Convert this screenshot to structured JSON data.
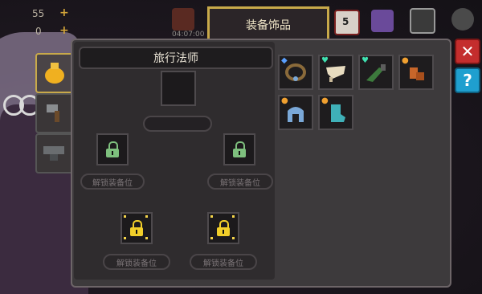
{
  "hud": {
    "count_top": "55",
    "count_second": "0",
    "timer": "04:07:00",
    "calendar_day": "5"
  },
  "tab": {
    "label": "装备饰品"
  },
  "panel": {
    "class_name": "旅行法师",
    "unlock_label": "解锁装备位"
  },
  "buttons": {
    "close_label": "✕",
    "help_label": "?"
  },
  "inventory": [
    {
      "name": "necklace-item",
      "color": "#8a6a3a",
      "badge": "blue"
    },
    {
      "name": "horn-item",
      "color": "#e8dcc0",
      "badge": "heart"
    },
    {
      "name": "herb-item",
      "color": "#3c7a3c",
      "badge": "heart"
    },
    {
      "name": "boots-item",
      "color": "#c7662a",
      "badge": "orange"
    },
    {
      "name": "gauntlet-item",
      "color": "#7aa8d8",
      "badge": "orange"
    },
    {
      "name": "sock-item",
      "color": "#3fb0b8",
      "badge": "orange"
    }
  ]
}
